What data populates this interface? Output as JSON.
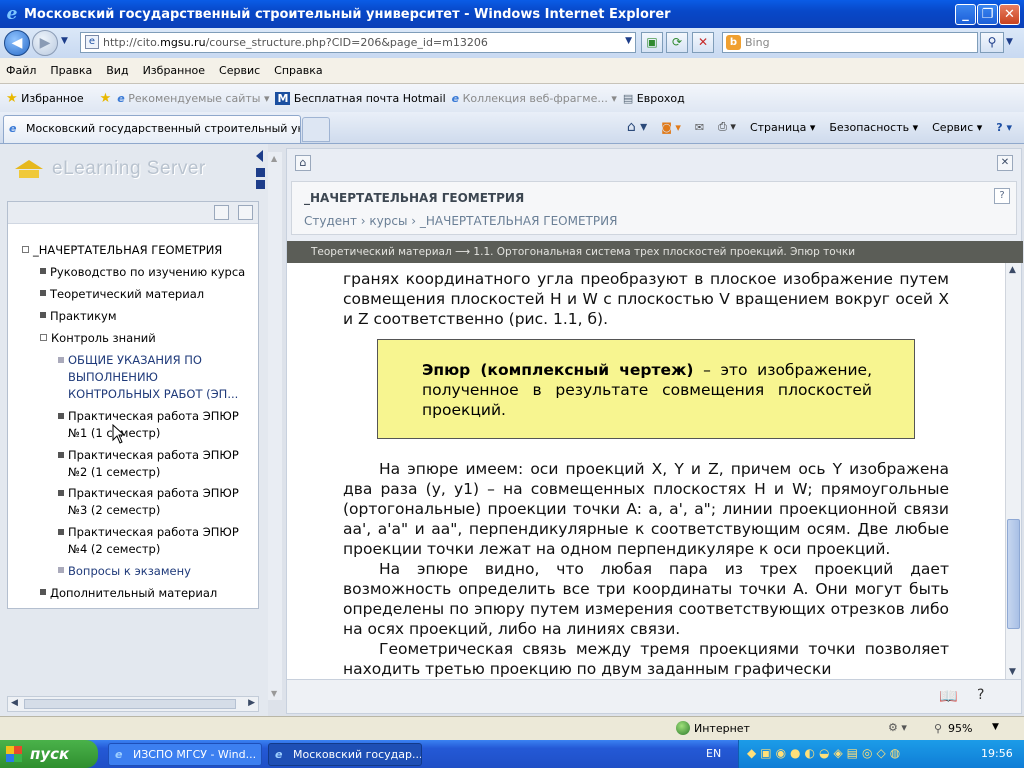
{
  "window": {
    "title": "Московский государственный строительный университет - Windows Internet Explorer"
  },
  "address": {
    "url_prefix": "http://cito.",
    "url_domain": "mgsu.ru",
    "url_rest": "/course_structure.php?CID=206&page_id=m13206",
    "search_placeholder": "Bing"
  },
  "menu": [
    "Файл",
    "Правка",
    "Вид",
    "Избранное",
    "Сервис",
    "Справка"
  ],
  "favorites": {
    "label": "Избранное",
    "items": [
      {
        "label": "Рекомендуемые сайты ▾",
        "muted": true
      },
      {
        "label": "Бесплатная почта Hotmail",
        "muted": false
      },
      {
        "label": "Коллекция веб-фрагме... ▾",
        "muted": true
      },
      {
        "label": "Евроход",
        "muted": false
      }
    ]
  },
  "tab": {
    "title": "Московский государственный строительный унив..."
  },
  "command_bar": [
    "Страница ▾",
    "Безопасность ▾",
    "Сервис ▾"
  ],
  "left": {
    "logo": "eLearning Server",
    "tree": {
      "root": "_НАЧЕРТАТЕЛЬНАЯ ГЕОМЕТРИЯ",
      "items": [
        "Руководство по изучению курса",
        "Теоретический материал",
        "Практикум",
        "Контроль знаний"
      ],
      "sub_items": [
        {
          "lines": [
            "ОБЩИЕ УКАЗАНИЯ ПО",
            "ВЫПОЛНЕНИЮ",
            "КОНТРОЛЬНЫХ РАБОТ (ЭП..."
          ]
        },
        {
          "lines": [
            "Практическая работа ЭПЮР",
            "№1 (1 семестр)"
          ]
        },
        {
          "lines": [
            "Практическая работа ЭПЮР",
            "№2 (1 семестр)"
          ]
        },
        {
          "lines": [
            "Практическая работа ЭПЮР",
            "№3 (2 семестр)"
          ]
        },
        {
          "lines": [
            "Практическая работа ЭПЮР",
            "№4 (2 семестр)"
          ]
        },
        {
          "lines": [
            "Вопросы к экзамену"
          ]
        }
      ],
      "last_item": "Дополнительный материал"
    }
  },
  "right": {
    "course_title": "_НАЧЕРТАТЕЛЬНАЯ ГЕОМЕТРИЯ",
    "breadcrumb": "Студент › курсы › _НАЧЕРТАТЕЛЬНАЯ ГЕОМЕТРИЯ",
    "section_path": "Теоретический материал ⟶ 1.1. Ортогональная система трех плоскостей проекций. Эпюр точки",
    "para1": "гранях координатного угла преобразуют в плоское изображение путем совмещения плоскостей H и W с плоскостью V вращением вокруг осей X и Z соответственно (рис. 1.1, б).",
    "definition_term": "Эпюр (комплексный чертеж)",
    "definition_rest": " – это изображение, полученное в результате совмещения плоскостей проекций.",
    "para2": "На эпюре имеем: оси проекций X, Y и Z, причем ось Y изображена два раза (y, y1) – на совмещенных плоскостях H и W; прямоугольные (ортогональные) проекции точки A: a, a', a\"; линии проекционной связи aa', a'a\" и aa\", перпендикулярные к соответствующим осям. Две любые проекции точки лежат на одном перпендикуляре к оси проекций.",
    "para3": "На эпюре видно, что любая пара из трех проекций дает возможность определить все три координаты точки A. Они могут быть определены по эпюру путем измерения соответствующих отрезков либо на осях проекций, либо на линиях связи.",
    "para4": "Геометрическая связь между тремя проекциями точки позволяет находить третью проекцию по двум заданным графически"
  },
  "status": {
    "zone": "Интернет",
    "zoom": "95%"
  },
  "taskbar": {
    "start": "пуск",
    "tasks": [
      "ИЗСПО МГСУ - Wind...",
      "Московский государ..."
    ],
    "lang": "EN",
    "time": "19:56"
  },
  "colors": {
    "title_bar": "#0848c8",
    "definition_bg": "#f7f590",
    "section_bar": "#5b5d57"
  }
}
